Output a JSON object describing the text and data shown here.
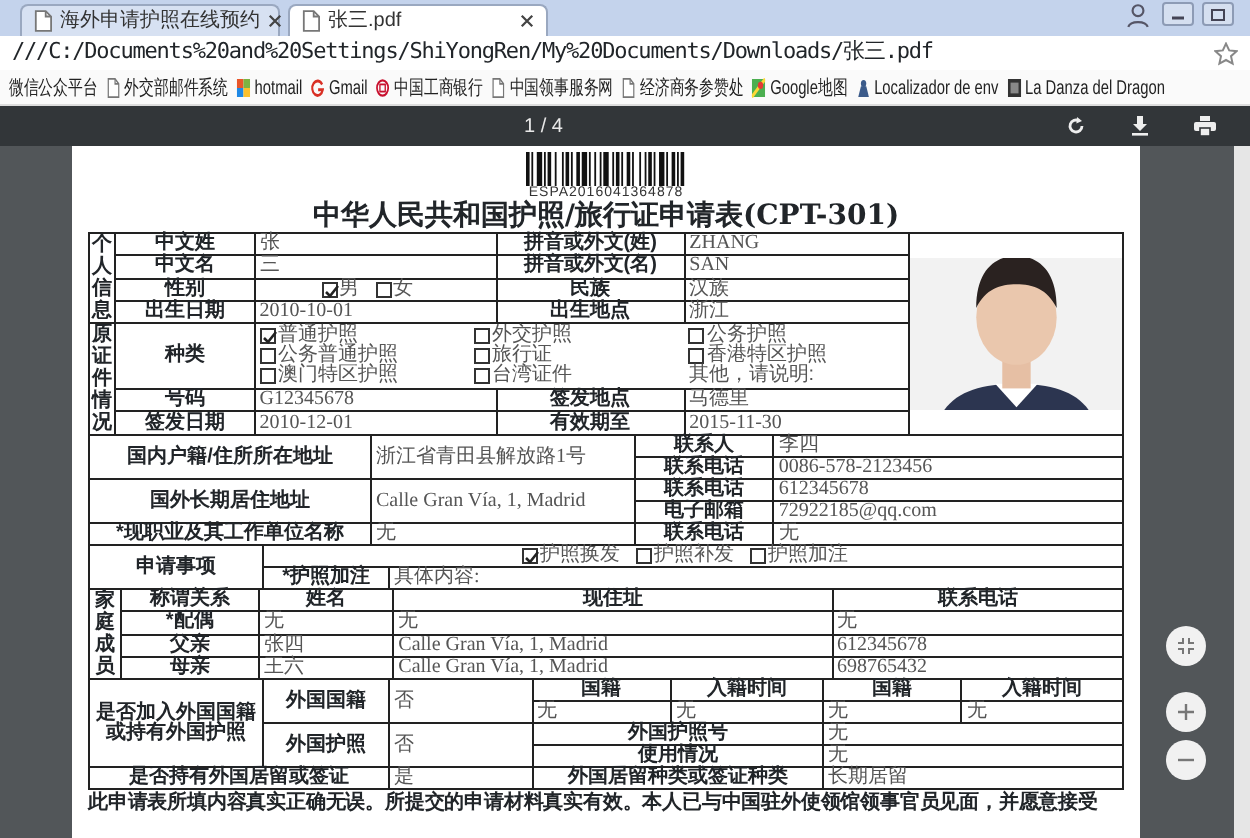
{
  "tabs": [
    {
      "title": "海外申请护照在线预约",
      "selected": false
    },
    {
      "title": "张三.pdf",
      "selected": true
    }
  ],
  "address": "///C:/Documents%20and%20Settings/ShiYongRen/My%20Documents/Downloads/张三.pdf",
  "bookmarks": [
    {
      "label": "微信公众平台",
      "kind": "none"
    },
    {
      "label": "外交部邮件系统",
      "kind": "doc"
    },
    {
      "label": "hotmail",
      "kind": "tiles"
    },
    {
      "label": "Gmail",
      "kind": "ring"
    },
    {
      "label": "中国工商银行",
      "kind": "bank"
    },
    {
      "label": "中国领事服务网",
      "kind": "doc"
    },
    {
      "label": "经济商务参赞处",
      "kind": "doc"
    },
    {
      "label": "Google地图",
      "kind": "map"
    },
    {
      "label": "Localizador de env",
      "kind": "figure"
    },
    {
      "label": "La Danza del Dragon",
      "kind": "dark"
    }
  ],
  "viewer": {
    "page_indicator": "1 / 4"
  },
  "document": {
    "barcode": "ESPA2016041364878",
    "title": "中华人民共和国护照/旅行证申请表(CPT-301)",
    "blocks": [
      {
        "rows": [
          [
            {
              "kind": "section",
              "text": "个人信息",
              "rowspan": 4
            },
            {
              "kind": "label",
              "text": "中文姓"
            },
            {
              "kind": "value",
              "text": "张"
            },
            {
              "kind": "label",
              "text": "拼音或外文(姓)"
            },
            {
              "kind": "value",
              "text": "ZHANG"
            },
            {
              "rowspan": 7
            }
          ],
          [
            {
              "kind": "label",
              "text": "中文名"
            },
            {
              "kind": "value",
              "text": "三"
            },
            {
              "kind": "label",
              "text": "拼音或外文(名)"
            },
            {
              "kind": "value",
              "text": "SAN"
            }
          ],
          [
            {
              "kind": "label",
              "text": "性别"
            },
            {
              "kind": "checks",
              "items": [
                {
                  "label": "男",
                  "checked": true
                },
                {
                  "label": "女",
                  "checked": false
                }
              ]
            },
            {
              "kind": "label",
              "text": "民族"
            },
            {
              "kind": "value",
              "text": "汉族"
            }
          ],
          [
            {
              "kind": "label",
              "text": "出生日期"
            },
            {
              "kind": "value",
              "text": "2010-10-01"
            },
            {
              "kind": "label",
              "text": "出生地点"
            },
            {
              "kind": "value",
              "text": "浙江"
            }
          ],
          [
            {
              "kind": "section",
              "text": "原证件情况",
              "rowspan": 3
            },
            {
              "kind": "label",
              "text": "种类"
            },
            {
              "kind": "checks",
              "colspan": 3,
              "items": [
                {
                  "label": "普通护照",
                  "checked": true
                },
                {
                  "label": "外交护照",
                  "checked": false
                },
                {
                  "label": "公务护照",
                  "checked": false
                },
                {
                  "label": "公务普通护照",
                  "checked": false
                },
                {
                  "label": "旅行证",
                  "checked": false
                },
                {
                  "label": "香港特区护照",
                  "checked": false
                },
                {
                  "label": "澳门特区护照",
                  "checked": false
                },
                {
                  "label": "台湾证件",
                  "checked": false
                },
                {
                  "label": "其他，请说明:"
                }
              ]
            }
          ],
          [
            {
              "kind": "label",
              "text": "号码"
            },
            {
              "kind": "value",
              "text": "G12345678"
            },
            {
              "kind": "label",
              "text": "签发地点"
            },
            {
              "kind": "value",
              "text": "马德里"
            }
          ],
          [
            {
              "kind": "label",
              "text": "签发日期"
            },
            {
              "kind": "value",
              "text": "2010-12-01"
            },
            {
              "kind": "label",
              "text": "有效期至"
            },
            {
              "kind": "value",
              "text": "2015-11-30"
            }
          ]
        ]
      },
      {
        "rows": [
          [
            {
              "kind": "label",
              "text": "国内户籍/住所所在地址",
              "rowspan": 2
            },
            {
              "kind": "value",
              "text": "浙江省青田县解放路1号",
              "rowspan": 2
            },
            {
              "kind": "label",
              "text": "联系人"
            },
            {
              "kind": "value",
              "text": "李四"
            }
          ],
          [
            {
              "kind": "label",
              "text": "联系电话"
            },
            {
              "kind": "value",
              "text": "0086-578-2123456"
            }
          ],
          [
            {
              "kind": "label",
              "text": "国外长期居住地址",
              "rowspan": 2
            },
            {
              "kind": "value",
              "text": "Calle Gran Vía, 1, Madrid",
              "rowspan": 2
            },
            {
              "kind": "label",
              "text": "联系电话"
            },
            {
              "kind": "value",
              "text": "612345678"
            }
          ],
          [
            {
              "kind": "label",
              "text": "电子邮箱"
            },
            {
              "kind": "value",
              "text": "72922185@qq.com"
            }
          ],
          [
            {
              "kind": "label",
              "text": "*现职业及其工作单位名称"
            },
            {
              "kind": "value",
              "text": "无"
            },
            {
              "kind": "label",
              "text": "联系电话"
            },
            {
              "kind": "value",
              "text": "无"
            }
          ]
        ]
      },
      {
        "rows": [
          [
            {
              "kind": "label",
              "text": "申请事项",
              "rowspan": 2
            },
            {
              "kind": "checks",
              "colspan": 2,
              "items": [
                {
                  "label": "护照换发",
                  "checked": true
                },
                {
                  "label": "护照补发",
                  "checked": false
                },
                {
                  "label": "护照加注",
                  "checked": false
                }
              ]
            }
          ],
          [
            {
              "kind": "label",
              "text": "*护照加注"
            },
            {
              "kind": "value",
              "text": "具体内容:"
            }
          ]
        ]
      },
      {
        "rows": [
          [
            {
              "kind": "section",
              "text": "家庭成员",
              "rowspan": 4
            },
            {
              "kind": "label",
              "text": "称谓关系"
            },
            {
              "kind": "label",
              "text": "姓名"
            },
            {
              "kind": "label",
              "text": "现住址"
            },
            {
              "kind": "label",
              "text": "联系电话"
            }
          ],
          [
            {
              "kind": "label",
              "text": "*配偶"
            },
            {
              "kind": "value",
              "text": "无"
            },
            {
              "kind": "value",
              "text": "无"
            },
            {
              "kind": "value",
              "text": "无"
            }
          ],
          [
            {
              "kind": "label",
              "text": "父亲"
            },
            {
              "kind": "value",
              "text": "张四"
            },
            {
              "kind": "value",
              "text": "Calle Gran Vía, 1, Madrid"
            },
            {
              "kind": "value",
              "text": "612345678"
            }
          ],
          [
            {
              "kind": "label",
              "text": "母亲"
            },
            {
              "kind": "value",
              "text": "王六"
            },
            {
              "kind": "value",
              "text": "Calle Gran Vía, 1, Madrid"
            },
            {
              "kind": "value",
              "text": "698765432"
            }
          ]
        ]
      },
      {
        "rows": [
          [
            {
              "kind": "label",
              "text": "是否加入外国国籍或持有外国护照",
              "rowspan": 4
            },
            {
              "kind": "label",
              "text": "外国国籍",
              "rowspan": 2
            },
            {
              "kind": "value",
              "text": "否",
              "rowspan": 2
            },
            {
              "kind": "label",
              "text": "国籍"
            },
            {
              "kind": "label",
              "text": "入籍时间"
            },
            {
              "kind": "label",
              "text": "国籍"
            },
            {
              "kind": "label",
              "text": "入籍时间"
            }
          ],
          [
            {
              "kind": "value",
              "text": "无"
            },
            {
              "kind": "value",
              "text": "无"
            },
            {
              "kind": "value",
              "text": "无"
            },
            {
              "kind": "value",
              "text": "无"
            }
          ],
          [
            {
              "kind": "label",
              "text": "外国护照",
              "rowspan": 2
            },
            {
              "kind": "value",
              "text": "否",
              "rowspan": 2
            },
            {
              "kind": "label",
              "text": "外国护照号",
              "colspan": 2
            },
            {
              "kind": "value",
              "text": "无",
              "colspan": 2
            }
          ],
          [
            {
              "kind": "label",
              "text": "使用情况",
              "colspan": 2
            },
            {
              "kind": "value",
              "text": "无",
              "colspan": 2
            }
          ],
          [
            {
              "kind": "label",
              "text": "是否持有外国居留或签证",
              "colspan": 2
            },
            {
              "kind": "value",
              "text": "是"
            },
            {
              "kind": "label",
              "text": "外国居留种类或签证种类",
              "colspan": 2
            },
            {
              "kind": "value",
              "text": "长期居留",
              "colspan": 2
            }
          ]
        ]
      }
    ],
    "footer": "此申请表所填内容真实正确无误。所提交的申请材料真实有效。本人已与中国驻外使领馆领事官员见面，并愿意接受"
  }
}
